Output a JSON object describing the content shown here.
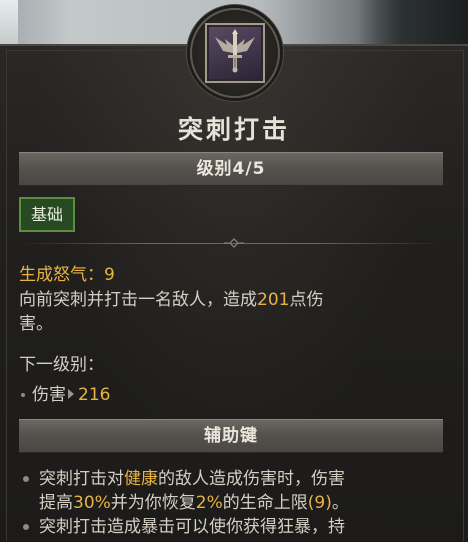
{
  "skill": {
    "title": "突刺打击",
    "rank_label": "级别4/5",
    "category_tag": "基础",
    "generate_label": "生成怒气：",
    "generate_value": "9",
    "description_part1": "向前突刺并打击一名敌人，造成",
    "description_damage": "201",
    "description_part2": "点伤",
    "description_part3": "害。",
    "next_rank_heading": "下一级别：",
    "next_damage_label": "伤害",
    "next_damage_value": "216"
  },
  "modifiers": {
    "heading": "辅助键",
    "items": [
      {
        "t1": "突刺打击对",
        "t2": "健康",
        "t3": "的敌人造成伤害时，伤害",
        "t4": "提高",
        "t5": "30%",
        "t6": "并为你恢复",
        "t7": "2%",
        "t8": "的生命上限",
        "t9": "(9)",
        "t10": "。"
      },
      {
        "t1": "突刺打击造成暴击可以使你获得狂暴，持"
      }
    ]
  },
  "icons": {
    "emblem": "sword-skill-icon"
  },
  "colors": {
    "highlight": "#e8b343",
    "tag_bg": "#284a23",
    "tag_border": "#5c8f3c"
  }
}
